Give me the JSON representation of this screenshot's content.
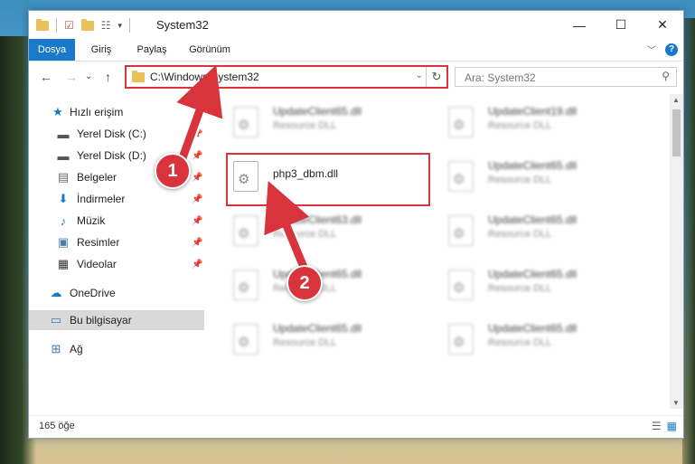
{
  "window": {
    "title": "System32",
    "minimize_glyph": "—",
    "maximize_glyph": "☐",
    "close_glyph": "✕"
  },
  "quick_access_toolbar": {
    "check_glyph": "☑",
    "props_glyph": "☷",
    "dropdown_glyph": "▾"
  },
  "ribbon": {
    "tabs": [
      "Dosya",
      "Giriş",
      "Paylaş",
      "Görünüm"
    ],
    "collapse_glyph": "﹀",
    "help_glyph": "?"
  },
  "navigation": {
    "back_glyph": "←",
    "forward_glyph": "→",
    "recent_glyph": "⌄",
    "up_glyph": "↑",
    "address": "C:\\Windows\\System32",
    "address_dropdown_glyph": "⌄",
    "refresh_glyph": "↻",
    "search_placeholder": "Ara: System32",
    "search_glyph": "⚲"
  },
  "sidebar": {
    "items": [
      {
        "label": "Hızlı erişim",
        "icon": "star-icon",
        "glyph": "★",
        "color": "#1979ca",
        "pinned": false,
        "selected": false
      },
      {
        "label": "Yerel Disk (C:)",
        "icon": "drive-icon",
        "glyph": "▬",
        "color": "#555555",
        "pinned": true,
        "selected": false
      },
      {
        "label": "Yerel Disk (D:)",
        "icon": "drive-icon",
        "glyph": "▬",
        "color": "#555555",
        "pinned": true,
        "selected": false
      },
      {
        "label": "Belgeler",
        "icon": "documents-icon",
        "glyph": "▤",
        "color": "#6a6a6a",
        "pinned": true,
        "selected": false
      },
      {
        "label": "İndirmeler",
        "icon": "downloads-icon",
        "glyph": "⬇",
        "color": "#1979ca",
        "pinned": true,
        "selected": false
      },
      {
        "label": "Müzik",
        "icon": "music-icon",
        "glyph": "♪",
        "color": "#1979ca",
        "pinned": true,
        "selected": false
      },
      {
        "label": "Resimler",
        "icon": "pictures-icon",
        "glyph": "▣",
        "color": "#4a7aa8",
        "pinned": true,
        "selected": false
      },
      {
        "label": "Videolar",
        "icon": "videos-icon",
        "glyph": "▦",
        "color": "#333333",
        "pinned": true,
        "selected": false
      },
      {
        "label": "OneDrive",
        "icon": "cloud-icon",
        "glyph": "☁",
        "color": "#1979ca",
        "pinned": false,
        "selected": false
      },
      {
        "label": "Bu bilgisayar",
        "icon": "computer-icon",
        "glyph": "▭",
        "color": "#3b78b8",
        "pinned": false,
        "selected": true
      },
      {
        "label": "Ağ",
        "icon": "network-icon",
        "glyph": "⊞",
        "color": "#3b78b8",
        "pinned": false,
        "selected": false
      }
    ],
    "pin_glyph": "📌"
  },
  "files": [
    {
      "name": "UpdateClient65.dll",
      "type": "Resource DLL",
      "blurred": true
    },
    {
      "name": "UpdateClient19.dll",
      "type": "Resource DLL",
      "blurred": true
    },
    {
      "name": "php3_dbm.dll",
      "type": "",
      "blurred": false
    },
    {
      "name": "UpdateClient65.dll",
      "type": "Resource DLL",
      "blurred": true
    },
    {
      "name": "UpdateClient63.dll",
      "type": "Resource DLL",
      "blurred": true
    },
    {
      "name": "UpdateClient65.dll",
      "type": "Resource DLL",
      "blurred": true
    },
    {
      "name": "UpdateClient65.dll",
      "type": "Resource DLL",
      "blurred": true
    },
    {
      "name": "UpdateClient65.dll",
      "type": "Resource DLL",
      "blurred": true
    },
    {
      "name": "UpdateClient65.dll",
      "type": "Resource DLL",
      "blurred": true
    },
    {
      "name": "UpdateClient65.dll",
      "type": "Resource DLL",
      "blurred": true
    }
  ],
  "statusbar": {
    "item_count": "165 öğe",
    "details_view_glyph": "☰",
    "icons_view_glyph": "▦"
  },
  "annotations": {
    "step1": "1",
    "step2": "2",
    "color": "#d9333b"
  }
}
